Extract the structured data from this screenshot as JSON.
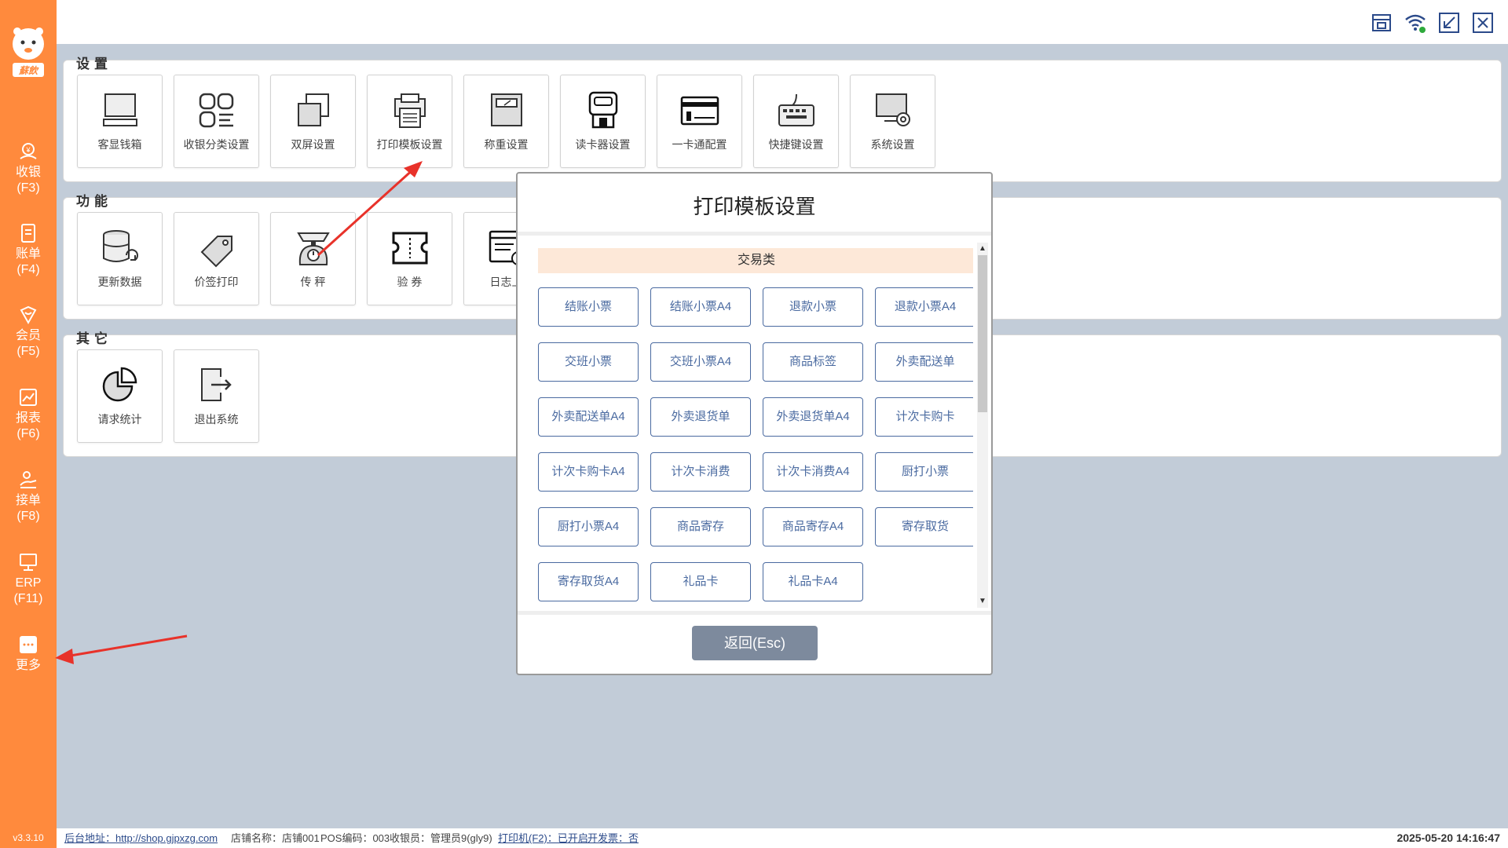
{
  "sidebar": {
    "logo_text": "蘇飲",
    "items": [
      {
        "label": "收银",
        "key": "(F3)"
      },
      {
        "label": "账单",
        "key": "(F4)"
      },
      {
        "label": "会员",
        "key": "(F5)"
      },
      {
        "label": "报表",
        "key": "(F6)"
      },
      {
        "label": "接单",
        "key": "(F8)"
      },
      {
        "label": "ERP",
        "key": "(F11)"
      },
      {
        "label": "更多",
        "key": ""
      }
    ],
    "version": "v3.3.10"
  },
  "topbar": {
    "icons": [
      "store-icon",
      "wifi-icon",
      "minimize-icon",
      "close-icon"
    ]
  },
  "sections": {
    "settings": {
      "title": "设置",
      "tiles": [
        "客显钱箱",
        "收银分类设置",
        "双屏设置",
        "打印模板设置",
        "称重设置",
        "读卡器设置",
        "一卡通配置",
        "快捷键设置",
        "系统设置"
      ]
    },
    "functions": {
      "title": "功能",
      "tiles": [
        "更新数据",
        "价签打印",
        "传 秤",
        "验 券",
        "日志上"
      ]
    },
    "others": {
      "title": "其它",
      "tiles": [
        "请求统计",
        "退出系统"
      ]
    }
  },
  "modal": {
    "title": "打印模板设置",
    "category": "交易类",
    "buttons": [
      "结账小票",
      "结账小票A4",
      "退款小票",
      "退款小票A4",
      "交班小票",
      "交班小票A4",
      "商品标签",
      "外卖配送单",
      "外卖配送单A4",
      "外卖退货单",
      "外卖退货单A4",
      "计次卡购卡",
      "计次卡购卡A4",
      "计次卡消费",
      "计次卡消费A4",
      "厨打小票",
      "厨打小票A4",
      "商品寄存",
      "商品寄存A4",
      "寄存取货",
      "寄存取货A4",
      "礼品卡",
      "礼品卡A4"
    ],
    "back_label": "返回(Esc)"
  },
  "statusbar": {
    "backend_label": "后台地址：",
    "backend_url": "http://shop.gjpxzg.com",
    "store": "店铺名称：店铺001",
    "pos": "POS编码：003",
    "cashier": "收银员：管理员9(gly9)",
    "printer": "打印机(F2)：已开启",
    "invoice": "开发票：否",
    "datetime": "2025-05-20 14:16:47"
  },
  "colors": {
    "sidebar": "#ff8a3d",
    "background": "#c2ccd8",
    "button_border": "#4a6aa0",
    "category_bg": "#fde8d8",
    "back_button": "#7d8a9d",
    "arrow": "#e8322a"
  }
}
